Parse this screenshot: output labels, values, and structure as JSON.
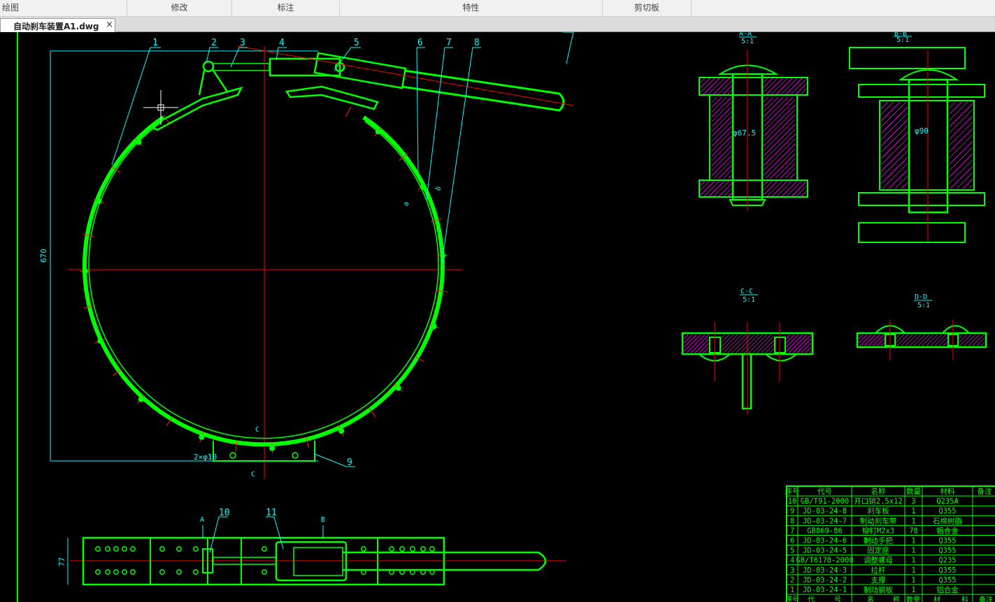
{
  "ribbon": {
    "groups": [
      "绘图",
      "修改",
      "标注",
      "特性",
      "剪切板"
    ]
  },
  "document_tab": {
    "title": "自动刹车装置A1.dwg",
    "close": "×"
  },
  "colors": {
    "part": "#00ff00",
    "dimension": "#00ffff",
    "centerline": "#ff0000",
    "hatch": "#ff00ff",
    "background": "#000000"
  },
  "drawing": {
    "main_view": {
      "balloons": [
        "1",
        "2",
        "3",
        "4",
        "5",
        "6",
        "7",
        "8",
        "9"
      ],
      "dim_height": "670",
      "hole_note": "2×φ10",
      "section_mark": "C",
      "side_mark_a": "a",
      "side_mark_b": "b"
    },
    "plan_view": {
      "balloons": [
        "10",
        "11"
      ],
      "dim_width": "77",
      "section_a": "A",
      "section_b": "B"
    },
    "section_aa": {
      "title": "A-A",
      "scale": "5:1",
      "diameter": "φ67.5"
    },
    "section_bb": {
      "title": "B-B",
      "scale": "5:1",
      "diameter": "φ90"
    },
    "section_cc": {
      "title": "C-C",
      "scale": "5:1"
    },
    "section_dd": {
      "title": "D-D",
      "scale": "5:1"
    }
  },
  "bom": {
    "headers": [
      "序号",
      "代号",
      "名称",
      "数量",
      "材料",
      "备注"
    ],
    "rows": [
      [
        "10",
        "GB/T91-2000",
        "开口销2.5x12",
        "3",
        "Q235A",
        ""
      ],
      [
        "9",
        "JD-03-24-8",
        "刹车板",
        "1",
        "Q355",
        ""
      ],
      [
        "8",
        "JD-03-24-7",
        "制动刹车带",
        "1",
        "石棉树脂",
        ""
      ],
      [
        "7",
        "GB869-86",
        "铆钉M2x3",
        "78",
        "铝合金",
        ""
      ],
      [
        "6",
        "JD-03-24-6",
        "制动手把",
        "1",
        "Q355",
        ""
      ],
      [
        "5",
        "JD-03-24-5",
        "固定座",
        "1",
        "Q355",
        ""
      ],
      [
        "4",
        "GB/T6170-2000",
        "调整螺母",
        "1",
        "Q235",
        ""
      ],
      [
        "3",
        "JD-03-24-3",
        "拉杆",
        "1",
        "Q355",
        ""
      ],
      [
        "2",
        "JD-03-24-2",
        "支撑",
        "1",
        "Q355",
        ""
      ],
      [
        "1",
        "JD-03-24-1",
        "制动钢板",
        "1",
        "铝合金",
        ""
      ]
    ],
    "footer": [
      "序号",
      "代",
      "号",
      "名",
      "称",
      "数量",
      "材",
      "料",
      "备注"
    ]
  }
}
